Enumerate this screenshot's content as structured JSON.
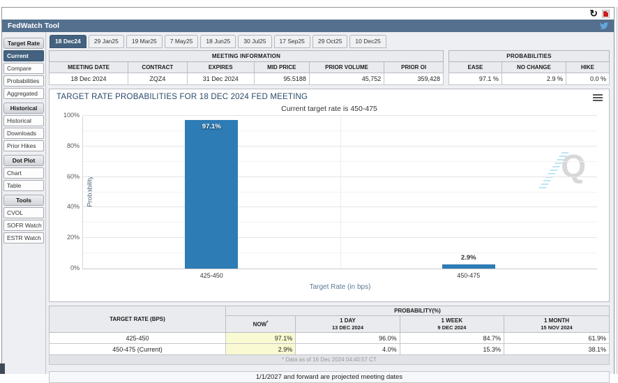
{
  "header": {
    "title": "FedWatch Tool"
  },
  "toolbar": {
    "icons": [
      "refresh-icon",
      "pdf-export-icon",
      "twitter-icon"
    ]
  },
  "sidebar": {
    "sections": [
      {
        "header": "Target Rate",
        "items": [
          {
            "label": "Current",
            "selected": true
          },
          {
            "label": "Compare"
          },
          {
            "label": "Probabilities"
          },
          {
            "label": "Aggregated"
          }
        ]
      },
      {
        "header": "Historical",
        "items": [
          {
            "label": "Historical"
          },
          {
            "label": "Downloads"
          },
          {
            "label": "Prior Hikes"
          }
        ]
      },
      {
        "header": "Dot Plot",
        "items": [
          {
            "label": "Chart"
          },
          {
            "label": "Table"
          }
        ]
      },
      {
        "header": "Tools",
        "items": [
          {
            "label": "CVOL"
          },
          {
            "label": "SOFR Watch"
          },
          {
            "label": "ESTR Watch"
          }
        ]
      }
    ]
  },
  "tabs": [
    {
      "label": "18 Dec24",
      "selected": true
    },
    {
      "label": "29 Jan25"
    },
    {
      "label": "19 Mar25"
    },
    {
      "label": "7 May25"
    },
    {
      "label": "18 Jun25"
    },
    {
      "label": "30 Jul25"
    },
    {
      "label": "17 Sep25"
    },
    {
      "label": "29 Oct25"
    },
    {
      "label": "10 Dec25"
    }
  ],
  "meeting_info": {
    "title": "MEETING INFORMATION",
    "columns": [
      "MEETING DATE",
      "CONTRACT",
      "EXPIRES",
      "MID PRICE",
      "PRIOR VOLUME",
      "PRIOR OI"
    ],
    "values": [
      "18 Dec 2024",
      "ZQZ4",
      "31 Dec 2024",
      "95.5188",
      "45,752",
      "359,428"
    ]
  },
  "probabilities_panel": {
    "title": "PROBABILITIES",
    "columns": [
      "EASE",
      "NO CHANGE",
      "HIKE"
    ],
    "values": [
      "97.1 %",
      "2.9 %",
      "0.0 %"
    ]
  },
  "chart_data": {
    "type": "bar",
    "title": "TARGET RATE PROBABILITIES FOR 18 DEC 2024 FED MEETING",
    "subtitle": "Current target rate is 450-475",
    "categories": [
      "425-450",
      "450-475"
    ],
    "values": [
      97.1,
      2.9
    ],
    "value_labels": [
      "97.1%",
      "2.9%"
    ],
    "xlabel": "Target Rate (in bps)",
    "ylabel": "Probability",
    "ylim": [
      0,
      100
    ],
    "yticks": [
      "0%",
      "20%",
      "40%",
      "60%",
      "80%",
      "100%"
    ],
    "grid": true,
    "legend": false,
    "bar_color": "#2d7cb5"
  },
  "bottom_table": {
    "col1_header": "TARGET RATE (BPS)",
    "group_header": "PROBABILITY(%)",
    "columns": [
      {
        "line1": "NOW",
        "sup": "*"
      },
      {
        "line1": "1 DAY",
        "line2": "13 DEC 2024"
      },
      {
        "line1": "1 WEEK",
        "line2": "9 DEC 2024"
      },
      {
        "line1": "1 MONTH",
        "line2": "15 NOV 2024"
      }
    ],
    "rows": [
      {
        "label": "425-450",
        "values": [
          "97.1%",
          "96.0%",
          "84.7%",
          "61.9%"
        ]
      },
      {
        "label": "450-475 (Current)",
        "values": [
          "2.9%",
          "4.0%",
          "15.3%",
          "38.1%"
        ]
      }
    ],
    "footnote": "* Data as of 16 Dec 2024 04:40:57 CT"
  },
  "footer": {
    "note": "1/1/2027 and forward are projected meeting dates"
  },
  "colors": {
    "titlebar_bg": "#54708e",
    "selected_bg": "#44627f",
    "bar": "#2d7cb5",
    "now_highlight": "#fafad2",
    "twitter_blue": "#62a9dc",
    "pdf_red": "#c8211d"
  }
}
